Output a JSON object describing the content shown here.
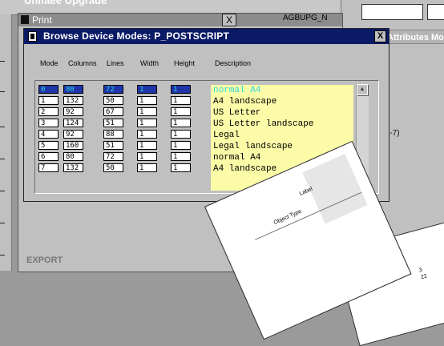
{
  "background": {
    "upgrade_window_title": "Unifaee Upgrade",
    "right_pane": {
      "tab_label": "Attributes Mode",
      "note": ")-7)"
    },
    "printer_name": "AGBUPG_N"
  },
  "print_window": {
    "title": "Print",
    "close_label": "X",
    "export_label": "EXPORT"
  },
  "dialog": {
    "title": "Browse Device Modes: P_POSTSCRIPT",
    "close_label": "X",
    "columns": [
      "Mode",
      "Columns",
      "Lines",
      "Width",
      "Height",
      "Description"
    ],
    "rows": [
      {
        "mode": "0",
        "columns": "80",
        "lines": "72",
        "width": "1",
        "height": "1",
        "description": "normal A4",
        "selected": true
      },
      {
        "mode": "1",
        "columns": "132",
        "lines": "50",
        "width": "1",
        "height": "1",
        "description": "A4 landscape",
        "selected": false
      },
      {
        "mode": "2",
        "columns": "92",
        "lines": "67",
        "width": "1",
        "height": "1",
        "description": "US Letter",
        "selected": false
      },
      {
        "mode": "3",
        "columns": "124",
        "lines": "51",
        "width": "1",
        "height": "1",
        "description": "US Letter landscape",
        "selected": false
      },
      {
        "mode": "4",
        "columns": "92",
        "lines": "88",
        "width": "1",
        "height": "1",
        "description": "Legal",
        "selected": false
      },
      {
        "mode": "5",
        "columns": "160",
        "lines": "51",
        "width": "1",
        "height": "1",
        "description": "Legal landscape",
        "selected": false
      },
      {
        "mode": "6",
        "columns": "80",
        "lines": "72",
        "width": "1",
        "height": "1",
        "description": "normal A4",
        "selected": false
      },
      {
        "mode": "7",
        "columns": "132",
        "lines": "50",
        "width": "1",
        "height": "1",
        "description": "A4 landscape",
        "selected": false
      }
    ],
    "scroll_up_icon": "triangle-up",
    "scroll_down_icon": "triangle-down"
  },
  "paper": {
    "label_object_type": "Object Type",
    "label_label": "Label",
    "page_ref_a": "3",
    "page_ref_b": "22"
  },
  "colors": {
    "dialog_title_bg": "#0a1a66",
    "selected_row_bg": "#1e34a8",
    "selected_row_text": "#2fd8d8",
    "description_bg": "#fbfba8"
  }
}
